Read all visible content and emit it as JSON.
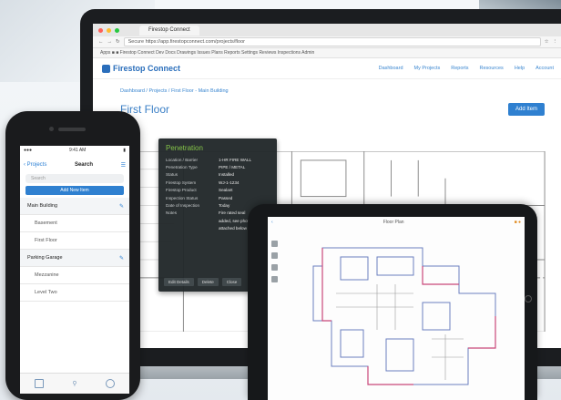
{
  "laptop": {
    "tab_title": "Firestop Connect",
    "url": "Secure https://app.firestopconnect.com/projects/floor",
    "bookmarks": "Apps  ■ ■  Firestop Connect  Dev  Docs  Drawings  Issues  Plans  Reports  Settings  Reviews  Inspections  Admin",
    "logo_text": "Firestop Connect",
    "nav_links": [
      "Dashboard",
      "My Projects",
      "Reports",
      "Resources",
      "Help",
      "Account"
    ],
    "breadcrumb": "Dashboard  /  Projects  /  First Floor - Main Building",
    "page_title": "First Floor",
    "add_button": "Add Item"
  },
  "popup": {
    "title": "Penetration",
    "rows": [
      {
        "k": "Location / Barrier",
        "v": "1-HR FIRE WALL"
      },
      {
        "k": "Penetration Type",
        "v": "PIPE / METAL"
      },
      {
        "k": "Status",
        "v": "Installed"
      },
      {
        "k": "Firestop System",
        "v": "WJ-1-1234"
      },
      {
        "k": "Firestop Product",
        "v": "Sealant"
      },
      {
        "k": "Inspection Status",
        "v": "Passed"
      },
      {
        "k": "Date of Inspection",
        "v": "Today"
      },
      {
        "k": "Notes",
        "v": "Fire rated seal"
      },
      {
        "k": "",
        "v": "added, see photos"
      },
      {
        "k": "",
        "v": "attached below"
      }
    ],
    "buttons": [
      "Edit Details",
      "Delete",
      "Close"
    ]
  },
  "phone": {
    "time": "9:41 AM",
    "back_label": "‹ Projects",
    "nav_title": "Search",
    "search_placeholder": "Search",
    "action_button": "Add New Item",
    "rows": [
      {
        "label": "Main Building",
        "type": "group"
      },
      {
        "label": "Basement",
        "type": "indent"
      },
      {
        "label": "First Floor",
        "type": "indent"
      },
      {
        "label": "Parking Garage",
        "type": "group"
      },
      {
        "label": "Mezzanine",
        "type": "indent"
      },
      {
        "label": "Level Two",
        "type": "indent"
      }
    ]
  },
  "tablet": {
    "title": "Floor Plan"
  },
  "colors": {
    "accent": "#2f80d0",
    "popup_title": "#7fc241",
    "plan_red": "#c9477a",
    "plan_blue": "#6a7fc0"
  }
}
